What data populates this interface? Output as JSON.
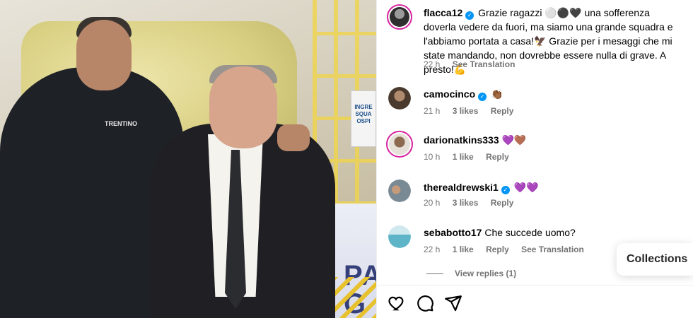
{
  "post": {
    "author": "flacca12",
    "caption": "Grazie ragazzi ⚪⚫🖤 una sofferenza doverla vedere da fuori, ma siamo una grande squadra e l'abbiamo portata a casa!🦅 Grazie per i mesaggi che mi state mandando, non dovrebbe essere nulla di grave. A presto!💪",
    "time": "22 h",
    "see_translation": "See Translation"
  },
  "photo": {
    "sign_text": "INGRE\nSQUA\nOSPI",
    "banner_text": "PA\nG",
    "jersey_text": "TRENTINO"
  },
  "comments": [
    {
      "user": "camocinco",
      "verified": true,
      "text": "👏🏾",
      "time": "21 h",
      "likes": "3 likes",
      "reply": "Reply",
      "avatar_color": "#5a4636",
      "ring": false
    },
    {
      "user": "darionatkins333",
      "verified": false,
      "text": "💜🤎",
      "time": "10 h",
      "likes": "1 like",
      "reply": "Reply",
      "avatar_color": "#7a5b45",
      "ring": true
    },
    {
      "user": "therealdrewski1",
      "verified": true,
      "text": "💜💜",
      "time": "20 h",
      "likes": "3 likes",
      "reply": "Reply",
      "avatar_color": "#6c7e8a",
      "ring": false
    },
    {
      "user": "sebabotto17",
      "verified": false,
      "text": "Che succede uomo?",
      "time": "22 h",
      "likes": "1 like",
      "reply": "Reply",
      "see_translation": "See Translation",
      "avatar_color": "#5fb5c8",
      "ring": false
    }
  ],
  "view_replies": "View replies (1)",
  "collections_label": "Collections",
  "icons": {
    "like": "heart-icon",
    "comment": "comment-icon",
    "share": "share-icon"
  },
  "colors": {
    "verified": "#0095f6",
    "meta": "#737373",
    "story_ring": "#d6249f"
  }
}
